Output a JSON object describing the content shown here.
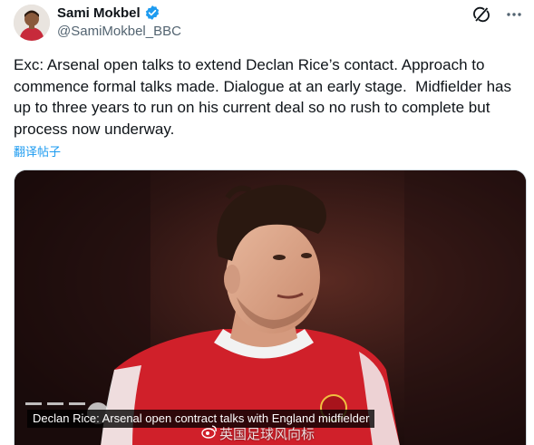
{
  "author": {
    "display_name": "Sami Mokbel",
    "handle": "@SamiMokbel_BBC",
    "verified": true,
    "verified_color": "#1d9bf0"
  },
  "icons": {
    "grok": "grok-icon",
    "more": "more-dots-icon",
    "verified": "verified-badge-icon"
  },
  "tweet": {
    "text": "Exc: Arsenal open talks to extend Declan Rice’s contact. Approach to commence formal talks made. Dialogue at an early stage.  Midfielder has up to three years to run on his current deal so no rush to complete but process now underway.",
    "translate_label": "翻译帖子"
  },
  "media": {
    "caption": "Declan Rice: Arsenal open contract talks with England midfielder",
    "watermark": "英国足球风向标"
  },
  "colors": {
    "link": "#1d9bf0",
    "text": "#0f1419",
    "secondary": "#536471",
    "kit_red": "#d0202a"
  }
}
